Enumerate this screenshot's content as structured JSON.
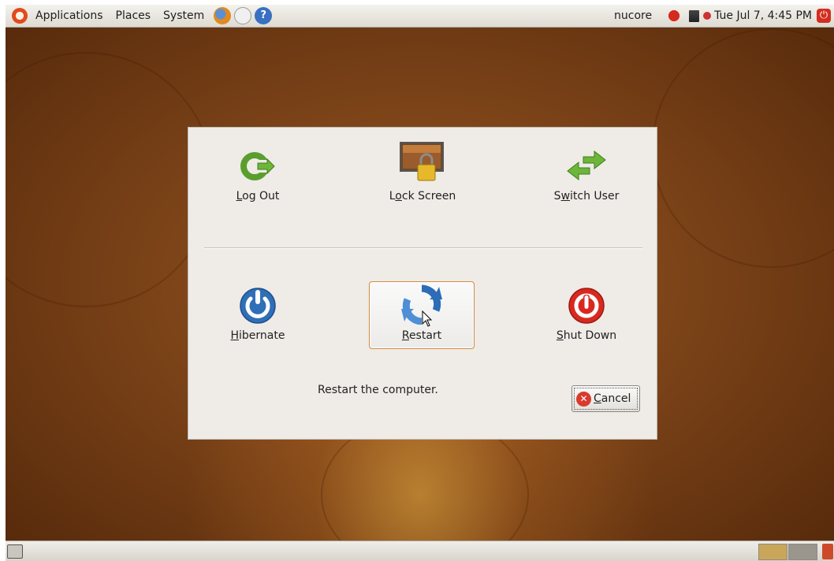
{
  "top_panel": {
    "menus": [
      "Applications",
      "Places",
      "System"
    ],
    "user": "nucore",
    "clock": "Tue Jul  7,  4:45 PM"
  },
  "dialog": {
    "actions": [
      {
        "label": "Log Out",
        "mnemonic": "L",
        "rest": "og Out",
        "icon": "logout-icon"
      },
      {
        "label": "Lock Screen",
        "pre": "L",
        "mnemonic": "o",
        "rest": "ck Screen",
        "icon": "lock-screen-icon"
      },
      {
        "label": "Switch User",
        "pre": "S",
        "mnemonic": "w",
        "rest": "itch User",
        "icon": "switch-user-icon"
      },
      {
        "label": "Hibernate",
        "mnemonic": "H",
        "rest": "ibernate",
        "icon": "hibernate-icon"
      },
      {
        "label": "Restart",
        "mnemonic": "R",
        "rest": "estart",
        "icon": "restart-icon"
      },
      {
        "label": "Shut Down",
        "mnemonic": "S",
        "rest": "hut Down",
        "icon": "shutdown-icon"
      }
    ],
    "description": "Restart the computer.",
    "cancel": {
      "label": "Cancel",
      "mnemonic": "C",
      "rest": "ancel"
    },
    "focused_action": "Restart"
  },
  "colors": {
    "focus_border": "#d28a3c",
    "desktop": "#7c4318",
    "cancel_icon": "#d83b2e"
  }
}
